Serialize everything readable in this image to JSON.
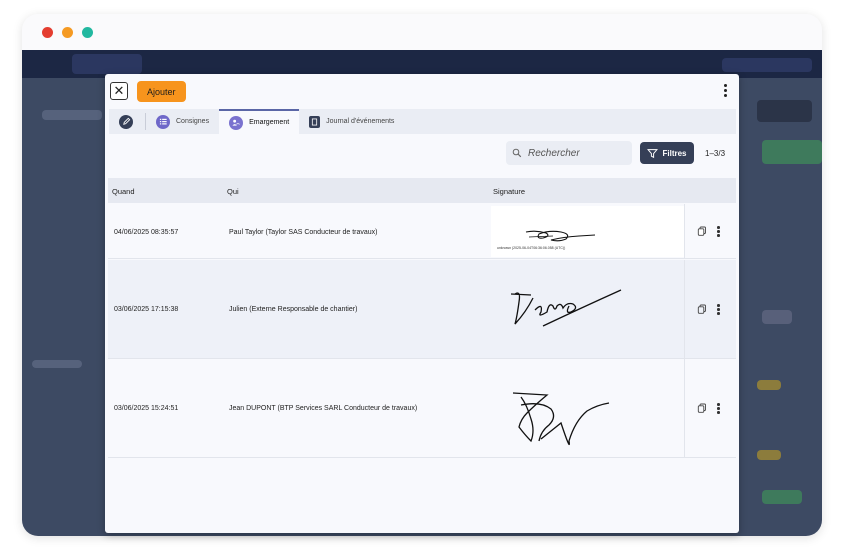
{
  "window": {
    "dot_colors": [
      "#e43d30",
      "#f59a23",
      "#22b8a0"
    ]
  },
  "header": {
    "add_label": "Ajouter"
  },
  "tabs": [
    {
      "label": "",
      "icon": "pen-icon"
    },
    {
      "label": "Consignes",
      "icon": "list-icon"
    },
    {
      "label": "Emargement",
      "icon": "signature-people-icon"
    },
    {
      "label": "Journal d'événements",
      "icon": "book-icon"
    }
  ],
  "toolbar": {
    "search_placeholder": "Rechercher",
    "filter_label": "Filtres",
    "count": "1–3/3"
  },
  "table": {
    "headers": {
      "when": "Quand",
      "who": "Qui",
      "signature": "Signature"
    },
    "rows": [
      {
        "when": "04/06/2025 08:35:57",
        "who": "Paul Taylor (Taylor SAS Conducteur de travaux)",
        "signature_caption": "unknown (2025-06-04T06:36:06.058 (UTC))"
      },
      {
        "when": "03/06/2025 17:15:38",
        "who": "Julien (Externe Responsable de chantier)",
        "signature_caption": ""
      },
      {
        "when": "03/06/2025 15:24:51",
        "who": "Jean DUPONT (BTP Services SARL Conducteur de travaux)",
        "signature_caption": ""
      }
    ]
  },
  "colors": {
    "accent": "#f7941d",
    "filter_bg": "#353f57",
    "tab_active_border": "#5a66a6"
  }
}
